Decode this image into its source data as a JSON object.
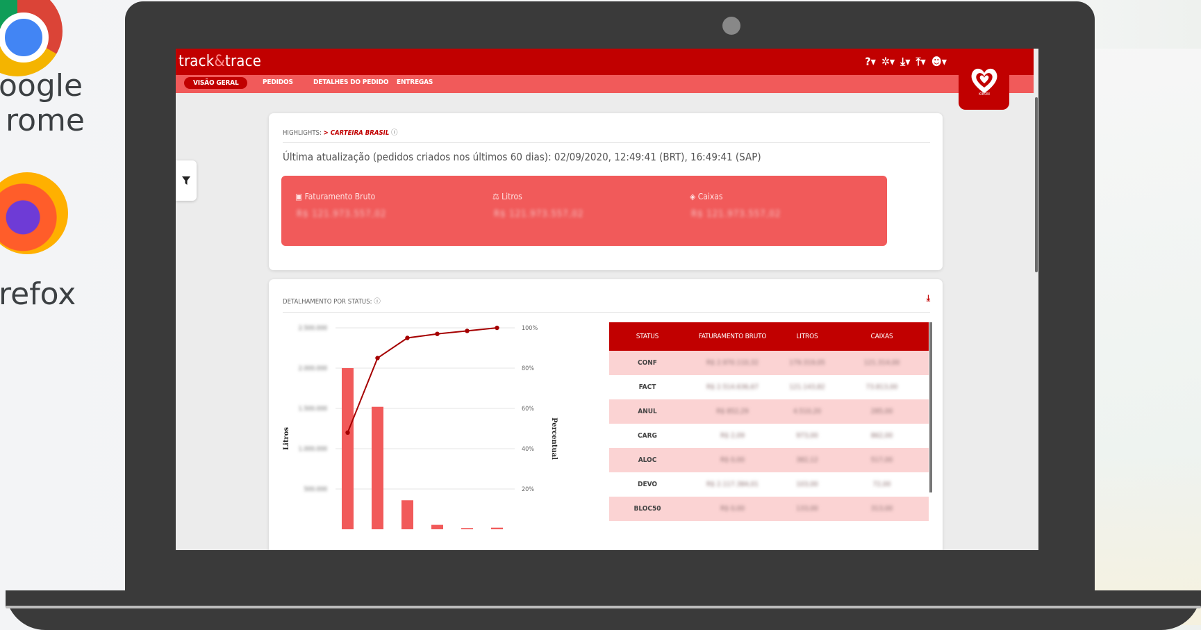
{
  "desktop": {
    "chrome_label_line1": "oogle",
    "chrome_label_line2": "rome",
    "firefox_label": "refox"
  },
  "app": {
    "brand_prefix": "track",
    "brand_amp": "&",
    "brand_suffix": "trace",
    "logo_text": "KIBON"
  },
  "nav": [
    {
      "label": "VISÃO GERAL",
      "active": true
    },
    {
      "label": "PEDIDOS"
    },
    {
      "label": "DETALHES DO PEDIDO"
    },
    {
      "label": "ENTREGAS"
    }
  ],
  "top_icons": [
    "help-icon",
    "gear-icon",
    "download-icon",
    "upload-icon",
    "user-icon"
  ],
  "highlights": {
    "title_prefix": "HIGHLIGHTS:",
    "title_accent": "> CARTEIRA BRASIL",
    "update_text": "Última atualização (pedidos criados nos últimos 60 dias): 02/09/2020, 12:49:41 (BRT), 16:49:41 (SAP)",
    "kpis": [
      {
        "label": "Faturamento Bruto",
        "icon": "money-icon",
        "value": "R$ 121.973.557,02"
      },
      {
        "label": "Litros",
        "icon": "scale-icon",
        "value": "R$ 121.973.557,02"
      },
      {
        "label": "Caixas",
        "icon": "box-icon",
        "value": "R$ 121.973.557,02"
      }
    ]
  },
  "status_section": {
    "title": "DETALHAMENTO POR STATUS:",
    "table": {
      "headers": [
        "STATUS",
        "FATURAMENTO BRUTO",
        "LITROS",
        "CAIXAS"
      ],
      "rows": [
        [
          "CONF",
          "R$ 2.970.110,32",
          "179.319,05",
          "121.314,00"
        ],
        [
          "FACT",
          "R$ 2.514.636,67",
          "121.143,82",
          "73.813,00"
        ],
        [
          "ANUL",
          "R$ 852,29",
          "4.510,20",
          "285,00"
        ],
        [
          "CARG",
          "R$ 2,09",
          "973,00",
          "862,00"
        ],
        [
          "ALOC",
          "R$ 0,00",
          "382,12",
          "517,00"
        ],
        [
          "DEVO",
          "R$ 2.117.384,01",
          "103,00",
          "72,00"
        ],
        [
          "BLOC50",
          "R$ 0,00",
          "133,00",
          "313,00"
        ]
      ]
    }
  },
  "chart_data": {
    "type": "bar",
    "ylabel": "Litros",
    "y2label": "Percentual",
    "y2_ticks": [
      "100%",
      "80%",
      "60%",
      "40%",
      "20%"
    ],
    "y_ticks": [
      "2.500.000",
      "2.000.000",
      "1.500.000",
      "1.000.000",
      "500.000"
    ],
    "values": [
      2000000,
      1520000,
      360000,
      55000,
      15000,
      20000
    ],
    "cumulative_percent": [
      48,
      85,
      95,
      97,
      98.5,
      100
    ],
    "series": [
      {
        "name": "Litros",
        "type": "bar",
        "color": "#f15a5a"
      },
      {
        "name": "Percentual",
        "type": "line",
        "color": "#a50000"
      }
    ],
    "ylim": [
      0,
      2500000
    ],
    "y2lim": [
      0,
      100
    ]
  }
}
